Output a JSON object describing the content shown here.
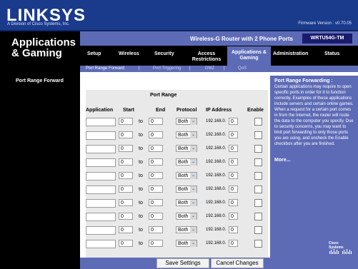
{
  "header": {
    "logo": "LINKSYS",
    "logo_sub": "A Division of Cisco Systems, Inc.",
    "firmware": "Firmware Version : v0.70.05"
  },
  "section": {
    "title_line1": "Applications",
    "title_line2": "& Gaming"
  },
  "product": {
    "name": "Wireless-G Router with 2 Phone Ports",
    "model": "WRTU54G-TM"
  },
  "nav": {
    "items": [
      {
        "label": "Setup"
      },
      {
        "label": "Wireless"
      },
      {
        "label": "Security"
      },
      {
        "label": "Access Restrictions"
      },
      {
        "label": "Applications & Gaming"
      },
      {
        "label": "Administration"
      },
      {
        "label": "Status"
      }
    ]
  },
  "subnav": {
    "items": [
      {
        "label": "Port Range Forward"
      },
      {
        "label": "Port Triggering"
      },
      {
        "label": "DMZ"
      },
      {
        "label": "QoS"
      }
    ]
  },
  "left": {
    "label": "Port Range Forward"
  },
  "table": {
    "title": "Port Range",
    "headers": {
      "application": "Application",
      "start": "Start",
      "end": "End",
      "protocol": "Protocol",
      "ip": "IP Address",
      "enable": "Enable"
    },
    "rows": [
      {
        "start": "0",
        "end": "0",
        "protocol": "Both",
        "ip_prefix": "192.168.0.",
        "ip_last": "0"
      },
      {
        "start": "0",
        "end": "0",
        "protocol": "Both",
        "ip_prefix": "192.168.0.",
        "ip_last": "0"
      },
      {
        "start": "0",
        "end": "0",
        "protocol": "Both",
        "ip_prefix": "192.168.0.",
        "ip_last": "0"
      },
      {
        "start": "0",
        "end": "0",
        "protocol": "Both",
        "ip_prefix": "192.168.0.",
        "ip_last": "0"
      },
      {
        "start": "0",
        "end": "0",
        "protocol": "Both",
        "ip_prefix": "192.168.0.",
        "ip_last": "0"
      },
      {
        "start": "0",
        "end": "0",
        "protocol": "Both",
        "ip_prefix": "192.168.0.",
        "ip_last": "0"
      },
      {
        "start": "0",
        "end": "0",
        "protocol": "Both",
        "ip_prefix": "192.168.0.",
        "ip_last": "0"
      },
      {
        "start": "0",
        "end": "0",
        "protocol": "Both",
        "ip_prefix": "192.168.0.",
        "ip_last": "0"
      },
      {
        "start": "0",
        "end": "0",
        "protocol": "Both",
        "ip_prefix": "192.168.0.",
        "ip_last": "0"
      },
      {
        "start": "0",
        "end": "0",
        "protocol": "Both",
        "ip_prefix": "192.168.0.",
        "ip_last": "0"
      }
    ],
    "to_label": "to"
  },
  "side": {
    "title": "Port Range Forwarding :",
    "text": "Certain applications may require to open specific ports in order for it to function correctly. Examples of these applications include servers and certain online games. When a request for a certain port comes in from the Internet, the router will route the data to the computer you specify. Due to security concerns, you may want to limit port forwarding to only those ports you are using, and uncheck the Enable checkbox after you are finished.",
    "more": "More..."
  },
  "buttons": {
    "save": "Save Settings",
    "cancel": "Cancel Changes"
  },
  "cisco": {
    "label": "Cisco Systems"
  }
}
